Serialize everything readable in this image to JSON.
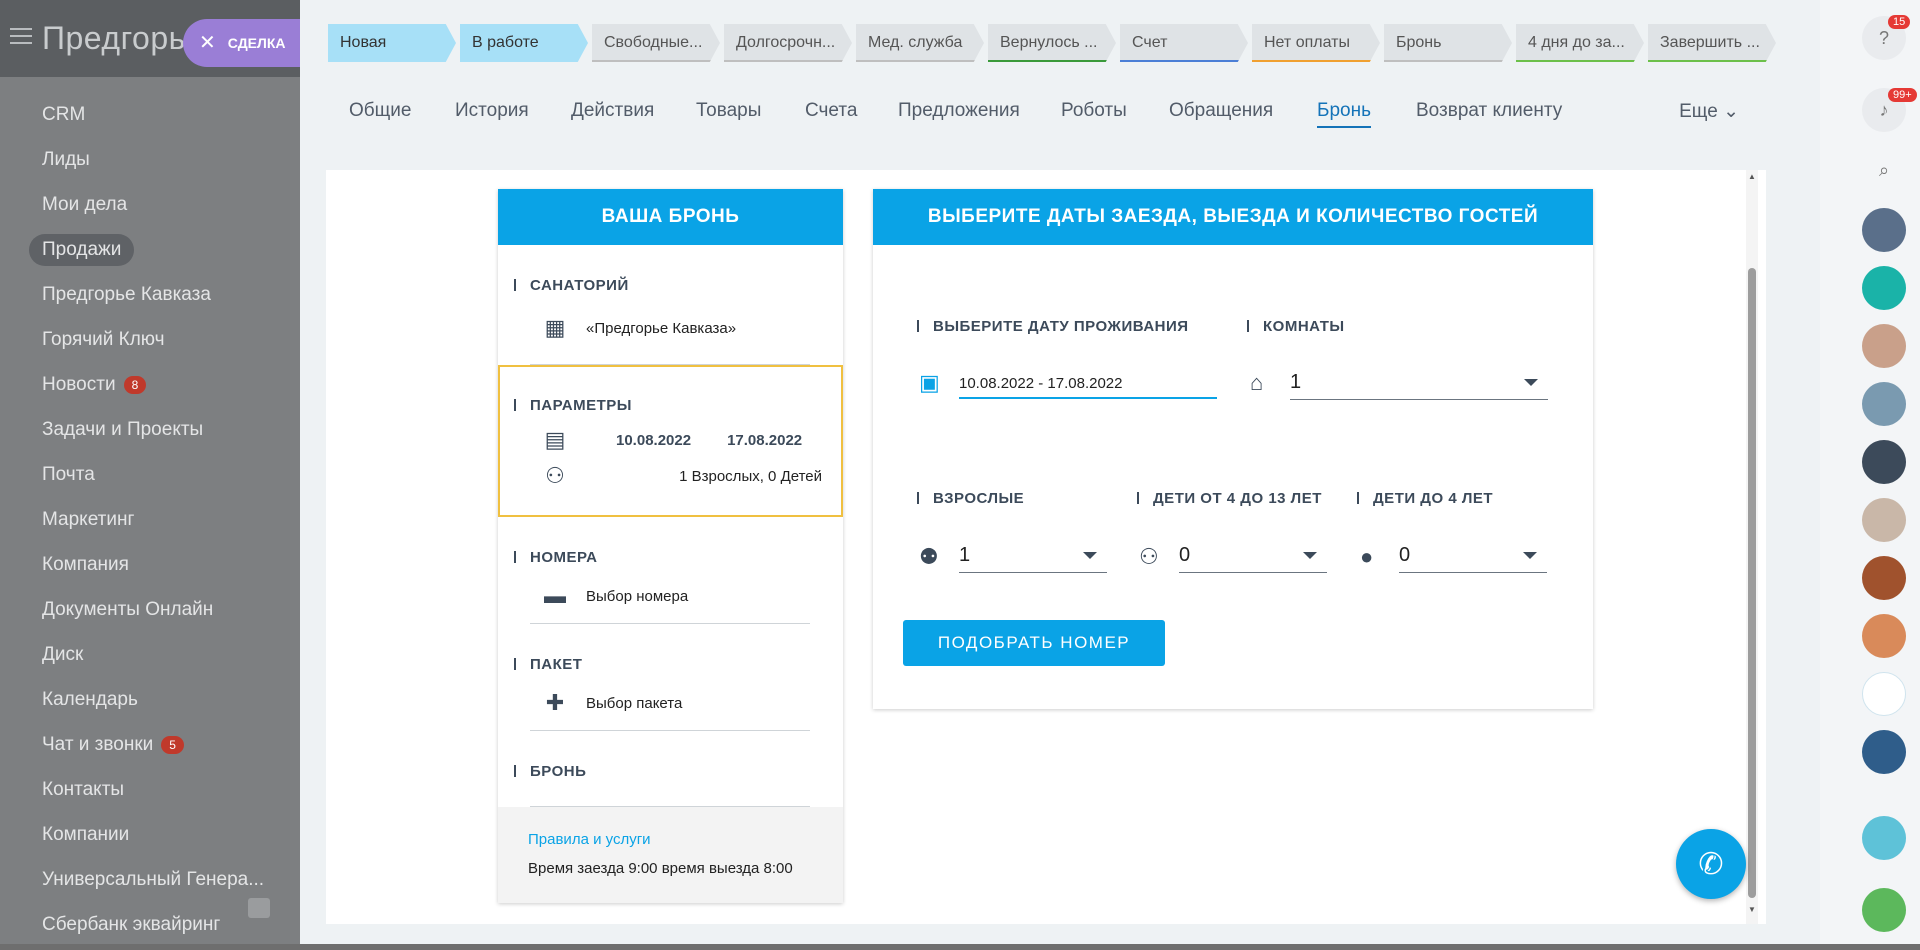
{
  "sidebar": {
    "brand": "Предгорь",
    "deal_chip": "СДЕЛКА",
    "items": [
      {
        "label": "CRM"
      },
      {
        "label": "Лиды"
      },
      {
        "label": "Мои дела"
      },
      {
        "label": "Продажи",
        "active": true
      },
      {
        "label": "Предгорье Кавказа"
      },
      {
        "label": "Горячий Ключ"
      },
      {
        "label": "Новости",
        "badge": "8"
      },
      {
        "label": "Задачи и Проекты"
      },
      {
        "label": "Почта"
      },
      {
        "label": "Маркетинг"
      },
      {
        "label": "Компания"
      },
      {
        "label": "Документы Онлайн"
      },
      {
        "label": "Диск"
      },
      {
        "label": "Календарь"
      },
      {
        "label": "Чат и звонки",
        "badge": "5"
      },
      {
        "label": "Контакты"
      },
      {
        "label": "Компании"
      },
      {
        "label": "Универсальный Генера..."
      },
      {
        "label": "Сбербанк эквайринг"
      }
    ]
  },
  "stages": [
    {
      "label": "Новая",
      "color": "#a7e0f7"
    },
    {
      "label": "В работе",
      "color": "#a7e0f7"
    },
    {
      "label": "Свободные...",
      "bar": "#bfbfbf"
    },
    {
      "label": "Долгосрочн...",
      "bar": "#bfbfbf"
    },
    {
      "label": "Мед. служба",
      "bar": "#bfbfbf"
    },
    {
      "label": "Вернулось ...",
      "bar": "#3a9a3a"
    },
    {
      "label": "Счет",
      "bar": "#4b7fd6"
    },
    {
      "label": "Нет оплаты",
      "bar": "#f0a030"
    },
    {
      "label": "Бронь",
      "bar": "#bfbfbf"
    },
    {
      "label": "4 дня до за...",
      "bar": "#6cc04a"
    },
    {
      "label": "Завершить ...",
      "bar": "#6cc04a"
    }
  ],
  "tabs": [
    "Общие",
    "История",
    "Действия",
    "Товары",
    "Счета",
    "Предложения",
    "Роботы",
    "Обращения",
    "Бронь",
    "Возврат клиенту"
  ],
  "tab_active": "Бронь",
  "tab_more": "Еще",
  "booking": {
    "header": "ВАША БРОНЬ",
    "sanatorium_title": "САНАТОРИЙ",
    "sanatorium_name": "«Предгорье Кавказа»",
    "params_title": "ПАРАМЕТРЫ",
    "date_from": "10.08.2022",
    "date_to": "17.08.2022",
    "guests": "1 Взрослых, 0 Детей",
    "rooms_title": "НОМЕРА",
    "rooms_value": "Выбор номера",
    "package_title": "ПАКЕТ",
    "package_value": "Выбор пакета",
    "bron_title": "БРОНЬ",
    "rules_link": "Правила и услуги",
    "rules_text": "Время заезда 9:00 время выезда 8:00"
  },
  "selector": {
    "header": "ВЫБЕРИТЕ ДАТЫ ЗАЕЗДА, ВЫЕЗДА И КОЛИЧЕСТВО ГОСТЕЙ",
    "date_label": "ВЫБЕРИТЕ ДАТУ ПРОЖИВАНИЯ",
    "date_value": "10.08.2022 - 17.08.2022",
    "rooms_label": "КОМНАТЫ",
    "rooms_value": "1",
    "adults_label": "ВЗРОСЛЫЕ",
    "adults_value": "1",
    "kids_4_13_label": "ДЕТИ ОТ 4 ДО 13 ЛЕТ",
    "kids_4_13_value": "0",
    "kids_under4_label": "ДЕТИ ДО 4 ЛЕТ",
    "kids_under4_value": "0",
    "find_button": "ПОДОБРАТЬ НОМЕР"
  },
  "rail": {
    "help_badge": "15",
    "notif_badge": "99+"
  },
  "colors": {
    "accent": "#0aa3e6",
    "active_tab": "#1473b8"
  }
}
